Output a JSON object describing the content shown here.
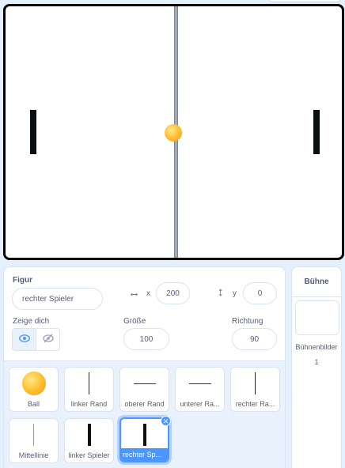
{
  "sprite_info": {
    "section_label": "Figur",
    "sprite_name": "rechter Spieler",
    "x_label": "x",
    "x_value": "200",
    "y_label": "y",
    "y_value": "0",
    "show_label": "Zeige dich",
    "size_label": "Größe",
    "size_value": "100",
    "direction_label": "Richtung",
    "direction_value": "90"
  },
  "sprites": [
    {
      "name": "Ball",
      "icon": "ball-icon"
    },
    {
      "name": "linker Rand",
      "icon": "vertical-line-icon"
    },
    {
      "name": "oberer Rand",
      "icon": "horizontal-line-icon"
    },
    {
      "name": "unterer Ra...",
      "icon": "horizontal-line-icon"
    },
    {
      "name": "rechter Ra...",
      "icon": "vertical-line-icon"
    },
    {
      "name": "Mittellinie",
      "icon": "thin-line-icon"
    },
    {
      "name": "linker Spieler",
      "icon": "paddle-icon"
    },
    {
      "name": "rechter Sp...",
      "icon": "paddle-icon",
      "selected": true
    }
  ],
  "stage_panel": {
    "title": "Bühne",
    "backdrops_label": "Bühnenbilder",
    "backdrops_count": "1"
  },
  "colors": {
    "accent": "#4c97ff",
    "background": "#e5f0ff"
  }
}
